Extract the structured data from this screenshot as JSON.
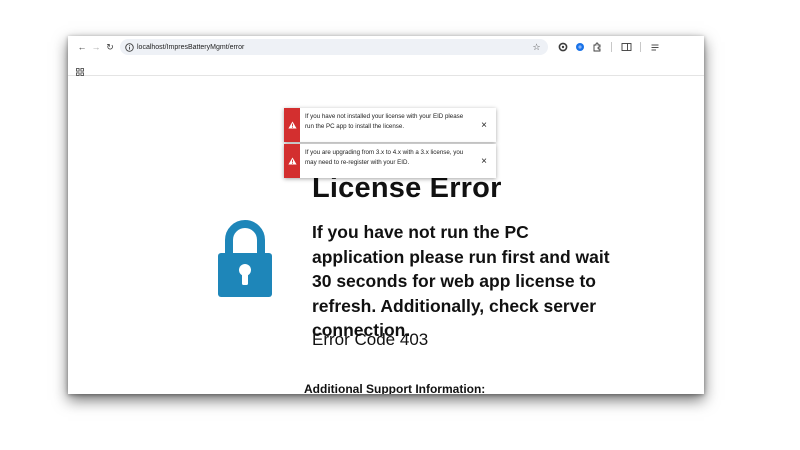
{
  "browser": {
    "url": "localhost/ImpresBatteryMgmt/error",
    "icons": {
      "back": "arrow-left-icon",
      "forward": "arrow-right-icon",
      "reload": "reload-icon",
      "site_info": "info-icon",
      "bookmark": "star-icon",
      "extensions": [
        "extension-gear-icon",
        "extension-blue-dot-icon",
        "puzzle-icon",
        "sidebar-icon",
        "menu-icon"
      ],
      "apps": "apps-grid-icon"
    }
  },
  "toasts": [
    {
      "message": "If you have not installed your license with your EID please run the PC app to install the license.",
      "icon": "warning-icon",
      "close_label": "×",
      "accent_color": "#d32f2f"
    },
    {
      "message": "If you are upgrading from 3.x to 4.x with a 3.x license, you may need to re-register with your EID.",
      "icon": "warning-icon",
      "close_label": "×",
      "accent_color": "#d32f2f"
    }
  ],
  "page": {
    "icon": "lock-icon",
    "icon_color": "#1e86b9",
    "title": "License Error",
    "message": "If you have not run the PC application please run first and wait 30 seconds for web app license to refresh. Additionally, check server connection.",
    "error_code": "Error Code 403",
    "support_heading": "Additional Support Information:"
  }
}
